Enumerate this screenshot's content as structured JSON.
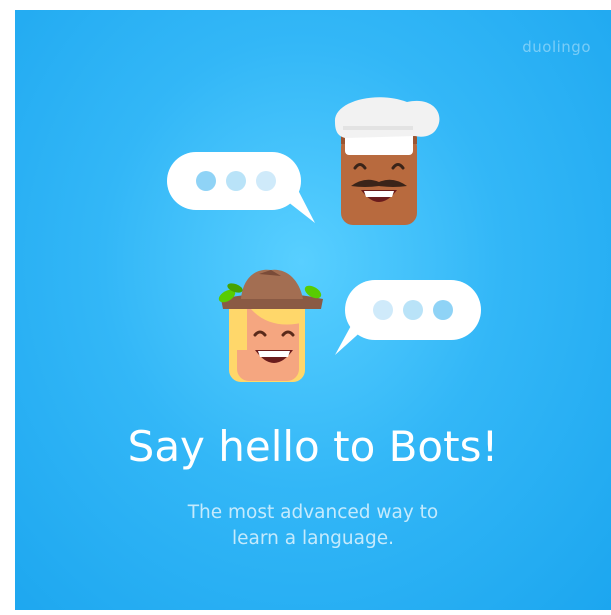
{
  "brand": {
    "name": "duolingo"
  },
  "headline": "Say hello to Bots!",
  "subtitle": {
    "line1": "The most advanced way to",
    "line2": "learn a language."
  },
  "illustration": {
    "characters": [
      "chef-bot-icon",
      "explorer-bot-icon"
    ],
    "bubbles": [
      "speech-bubble-icon",
      "speech-bubble-icon"
    ]
  },
  "colors": {
    "background": "#33b7f7",
    "bubble": "#ffffff",
    "dots": "#8fd3f6",
    "chef_skin": "#b86a3e",
    "hat_white": "#f2f2f2",
    "explorer_skin": "#f5a680",
    "hair": "#ffd76a",
    "explorer_hat": "#8a5a44",
    "leaf": "#58cc02"
  }
}
